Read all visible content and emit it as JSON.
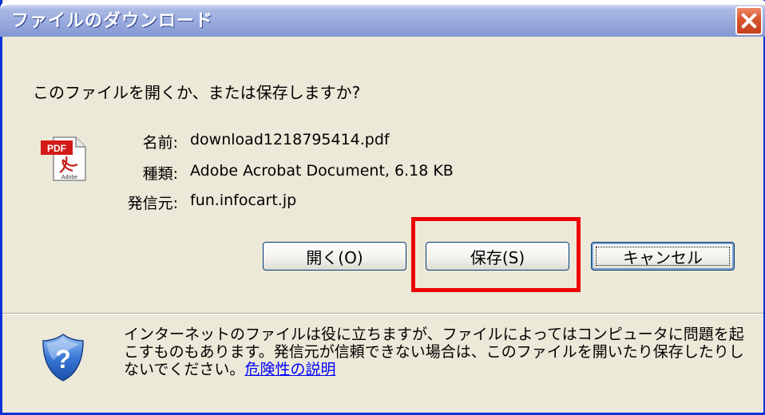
{
  "window": {
    "title": "ファイルのダウンロード",
    "close_label": "×"
  },
  "dialog": {
    "question": "このファイルを開くか、または保存しますか?",
    "file_icon": "pdf-file-icon",
    "fields": {
      "name_label": "名前:",
      "name_value": "download1218795414.pdf",
      "type_label": "種類:",
      "type_value": "Adobe Acrobat Document, 6.18 KB",
      "from_label": "発信元:",
      "from_value": "fun.infocart.jp"
    },
    "buttons": {
      "open": "開く(O)",
      "save": "保存(S)",
      "cancel": "キャンセル"
    },
    "warning_text": "インターネットのファイルは役に立ちますが、ファイルによってはコンピュータに問題を起こすものもあります。発信元が信頼できない場合は、このファイルを開いたり保存したりしないでください。",
    "warning_link": "危険性の説明",
    "warning_icon": "security-shield-icon"
  },
  "colors": {
    "highlight": "#ee0000",
    "dialog_bg": "#ece9d8",
    "link": "#0000ff"
  }
}
